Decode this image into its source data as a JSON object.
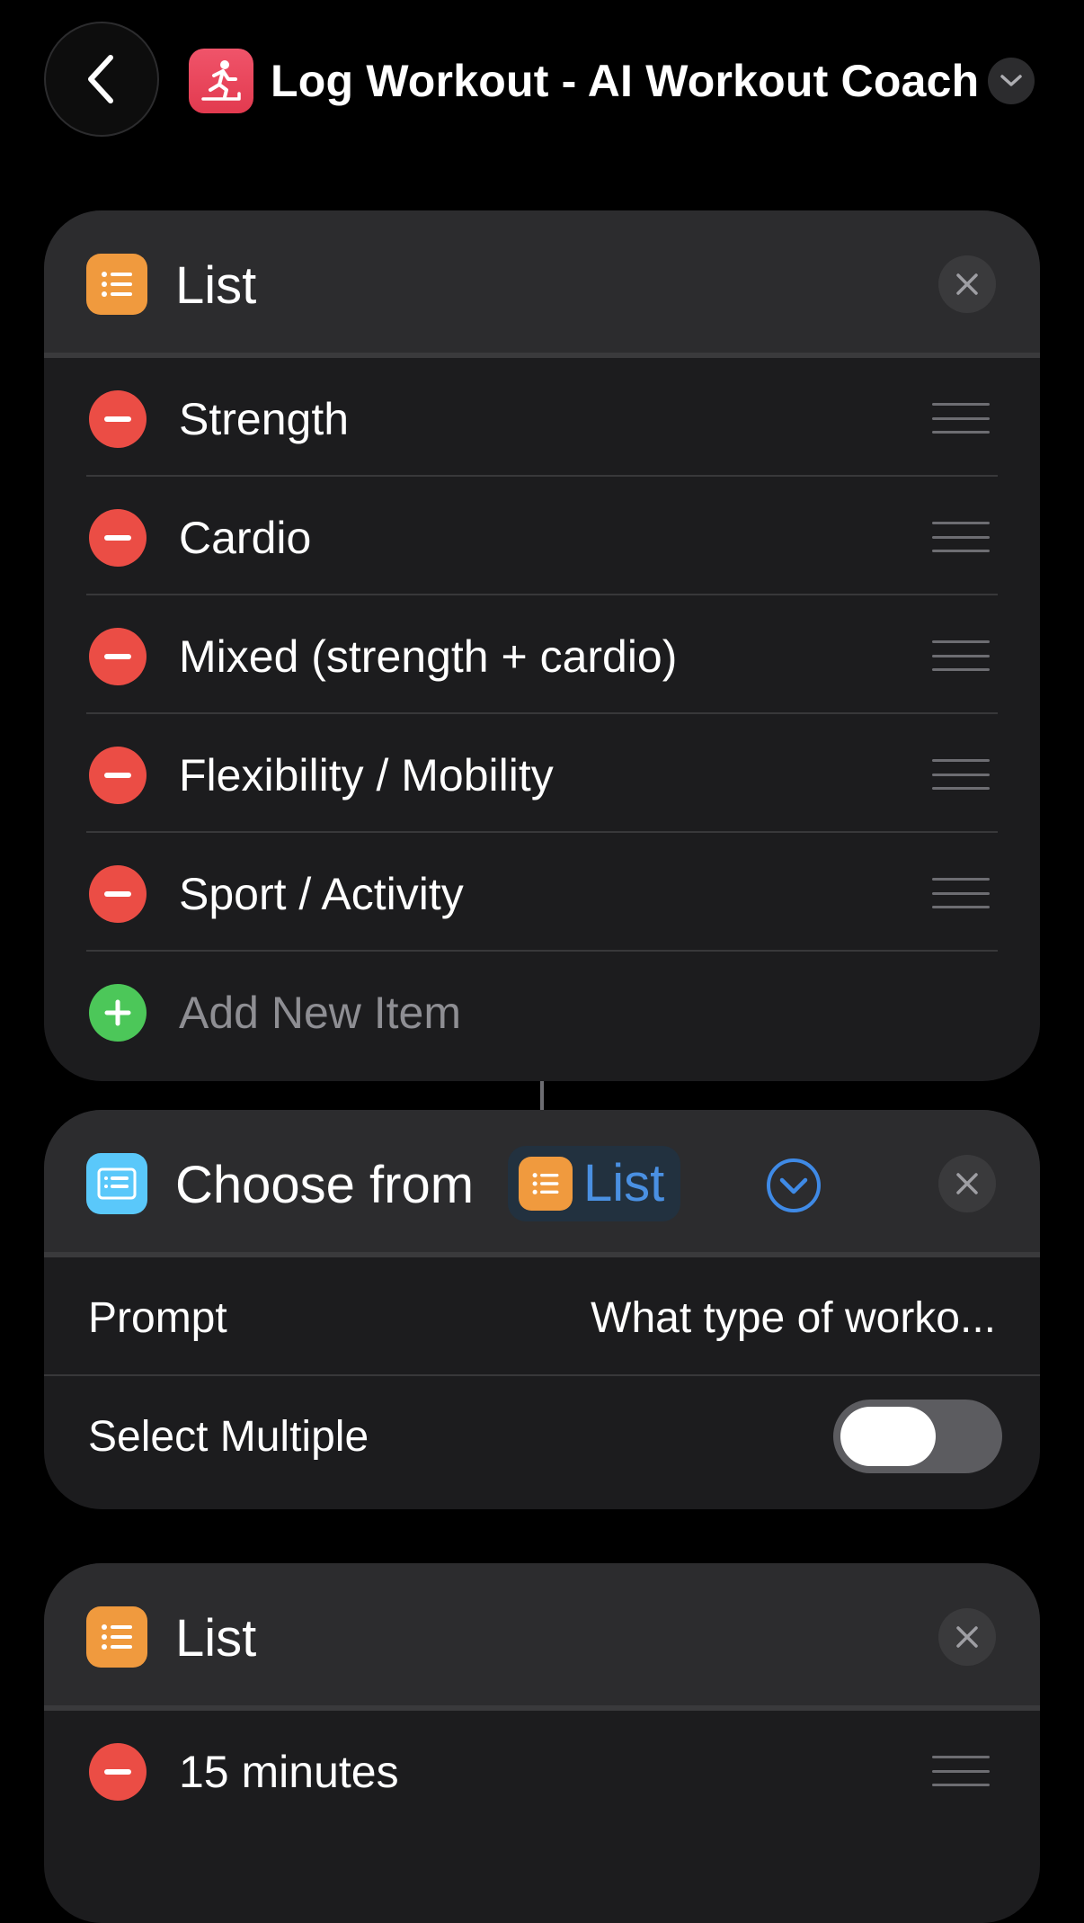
{
  "header": {
    "title": "Log Workout - AI Workout Coach",
    "app_icon": "treadmill-runner-icon",
    "back_icon": "chevron-left-icon",
    "menu_icon": "chevron-down-icon"
  },
  "list_card_1": {
    "title": "List",
    "icon": "list-icon",
    "items": [
      {
        "label": "Strength"
      },
      {
        "label": "Cardio"
      },
      {
        "label": "Mixed (strength + cardio)"
      },
      {
        "label": "Flexibility / Mobility"
      },
      {
        "label": "Sport / Activity"
      }
    ],
    "add_label": "Add New Item"
  },
  "choose_card": {
    "title": "Choose from",
    "variable_label": "List",
    "prompt_label": "Prompt",
    "prompt_value": "What type of worko...",
    "multiple_label": "Select Multiple",
    "multiple_on": false
  },
  "list_card_2": {
    "title": "List",
    "items": [
      {
        "label": "15 minutes"
      }
    ]
  },
  "colors": {
    "background": "#000000",
    "card": "#1c1c1e",
    "card_header": "#2c2c2e",
    "list_icon": "#f09a3e",
    "choose_icon": "#5ac8fa",
    "remove": "#eb4d45",
    "add": "#4cc759",
    "accent": "#4a90e2"
  }
}
